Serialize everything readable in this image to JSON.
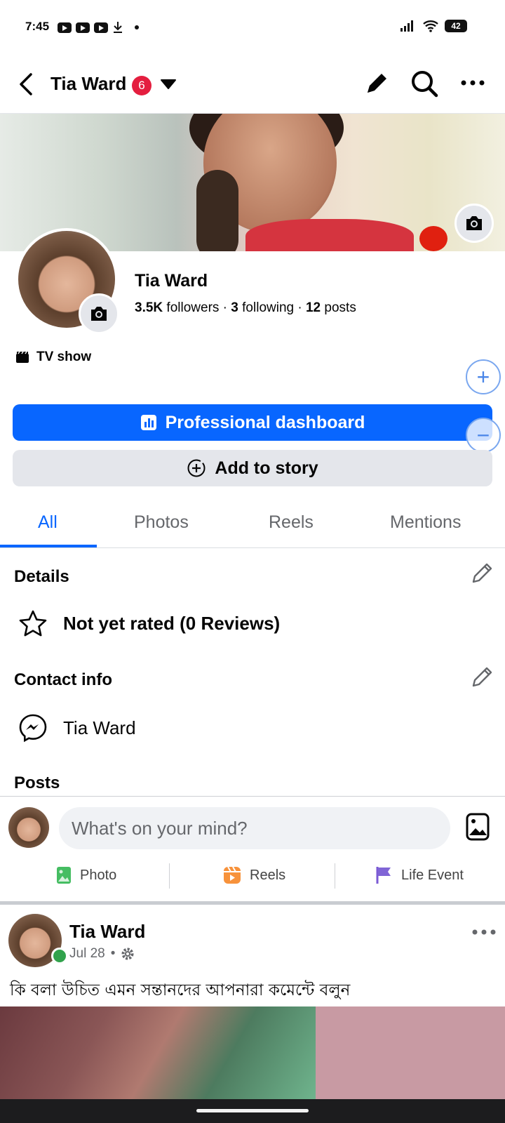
{
  "status_bar": {
    "time": "7:45",
    "battery": "42"
  },
  "header": {
    "title": "Tia Ward",
    "badge_count": "6"
  },
  "profile": {
    "name": "Tia Ward",
    "followers_count": "3.5K",
    "followers_label": "followers",
    "following_count": "3",
    "following_label": "following",
    "posts_count": "12",
    "posts_label": "posts",
    "category": "TV show"
  },
  "buttons": {
    "dashboard": "Professional dashboard",
    "add_story": "Add to story"
  },
  "tabs": [
    {
      "label": "All",
      "active": true
    },
    {
      "label": "Photos",
      "active": false
    },
    {
      "label": "Reels",
      "active": false
    },
    {
      "label": "Mentions",
      "active": false
    }
  ],
  "details": {
    "title": "Details",
    "rating": "Not yet rated (0 Reviews)"
  },
  "contact": {
    "title": "Contact info",
    "messenger": "Tia Ward"
  },
  "posts_section": {
    "title": "Posts"
  },
  "composer": {
    "placeholder": "What's on your mind?",
    "actions": [
      "Photo",
      "Reels",
      "Life Event"
    ]
  },
  "post": {
    "author": "Tia Ward",
    "date": "Jul 28",
    "separator": "•",
    "text": "কি বলা উচিত এমন সন্তানদের আপনারা কমেন্টে বলুন"
  },
  "colors": {
    "primary": "#0866ff",
    "badge": "#e41e3f",
    "online": "#31a24c"
  }
}
